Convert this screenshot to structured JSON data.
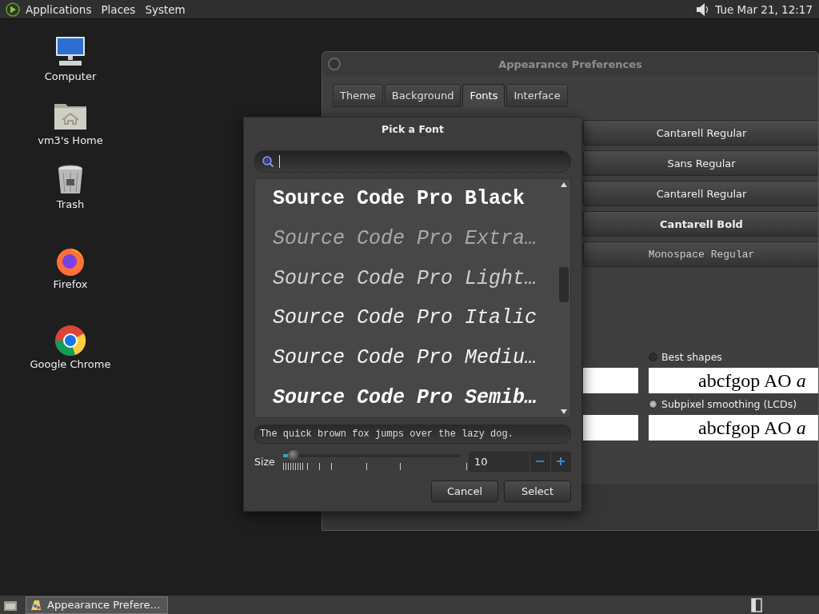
{
  "top_panel": {
    "menus": [
      "Applications",
      "Places",
      "System"
    ],
    "clock": "Tue Mar 21, 12:17"
  },
  "desktop_icons": [
    {
      "label": "Computer",
      "kind": "computer"
    },
    {
      "label": "vm3's Home",
      "kind": "home"
    },
    {
      "label": "Trash",
      "kind": "trash"
    },
    {
      "label": "Firefox",
      "kind": "firefox"
    },
    {
      "label": "Google Chrome",
      "kind": "chrome"
    }
  ],
  "appearance_window": {
    "title": "Appearance Preferences",
    "tabs": [
      {
        "label": "Theme",
        "selected": false
      },
      {
        "label": "Background",
        "selected": false
      },
      {
        "label": "Fonts",
        "selected": true
      },
      {
        "label": "Interface",
        "selected": false
      }
    ],
    "font_buttons": [
      {
        "label": "Cantarell Regular",
        "kind": "regular"
      },
      {
        "label": "Sans Regular",
        "kind": "regular"
      },
      {
        "label": "Cantarell Regular",
        "kind": "regular"
      },
      {
        "label": "Cantarell Bold",
        "kind": "bold"
      },
      {
        "label": "Monospace Regular",
        "kind": "mono"
      }
    ],
    "rendering_options": [
      {
        "label": "Best shapes",
        "selected": false,
        "sample": "abcfgop AO *a*"
      },
      {
        "label": "Subpixel smoothing (LCDs)",
        "selected": true,
        "sample": "abcfgop AO *a*"
      }
    ]
  },
  "font_dialog": {
    "title": "Pick a Font",
    "fonts": [
      {
        "name": "Source Code Pro Black",
        "kind": "black",
        "selected": false
      },
      {
        "name": "Source Code Pro Extra…",
        "kind": "extralight-italic",
        "selected": false
      },
      {
        "name": "Source Code Pro Light…",
        "kind": "light-italic",
        "selected": false
      },
      {
        "name": "Source Code Pro Italic",
        "kind": "italic",
        "selected": false
      },
      {
        "name": "Source Code Pro Mediu…",
        "kind": "medium-italic",
        "selected": false
      },
      {
        "name": "Source Code Pro Semib…",
        "kind": "semibold-italic",
        "selected": false
      }
    ],
    "preview": "The quick brown fox jumps over the lazy dog.",
    "size_label": "Size",
    "size": {
      "level": 0.03,
      "value": "10"
    },
    "buttons": [
      "Cancel",
      "Select"
    ]
  },
  "taskbar": {
    "tasks": [
      {
        "label": "Appearance Prefere…",
        "selected": true
      }
    ]
  }
}
